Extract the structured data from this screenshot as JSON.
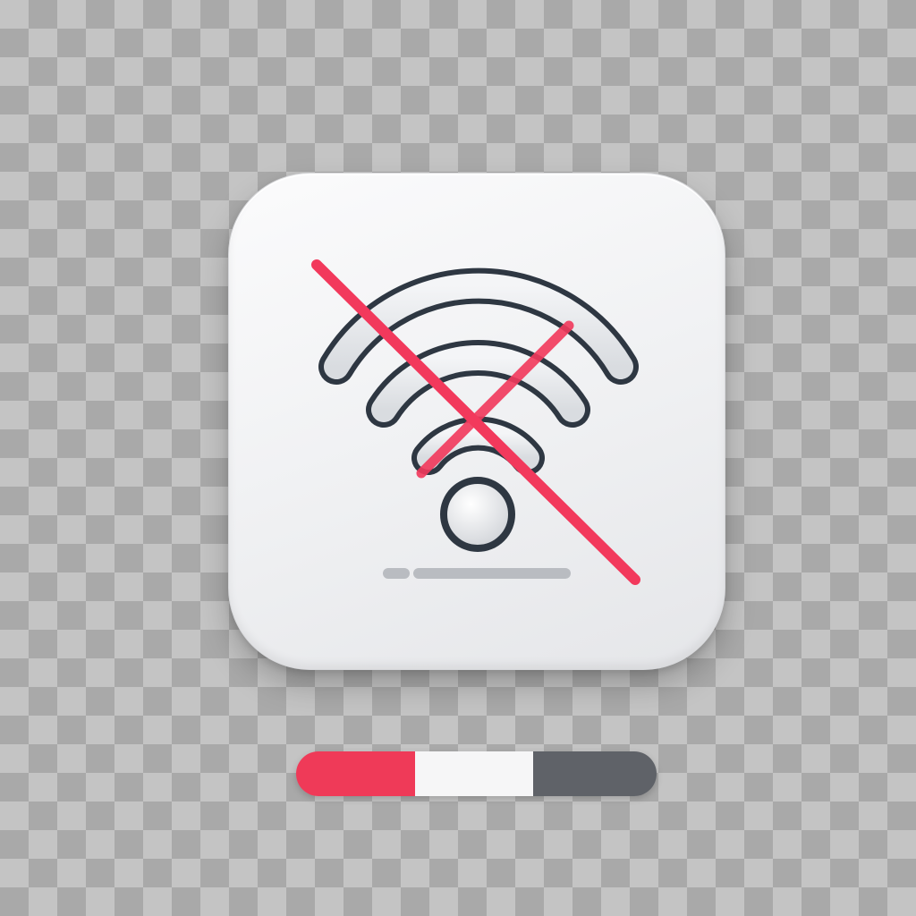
{
  "icon": {
    "name": "wifi-off-icon",
    "state": "disconnected",
    "colors": {
      "outline": "#2e3742",
      "arc_fill": "#e6e8eb",
      "slash": "#f2395c",
      "indicator_bar": "#b9bcc1",
      "tile": "#f2f3f5"
    }
  },
  "status_bar": {
    "segments": [
      {
        "name": "red",
        "color": "#ef3a58"
      },
      {
        "name": "white",
        "color": "#f6f6f7"
      },
      {
        "name": "gray",
        "color": "#5f6268"
      }
    ]
  }
}
